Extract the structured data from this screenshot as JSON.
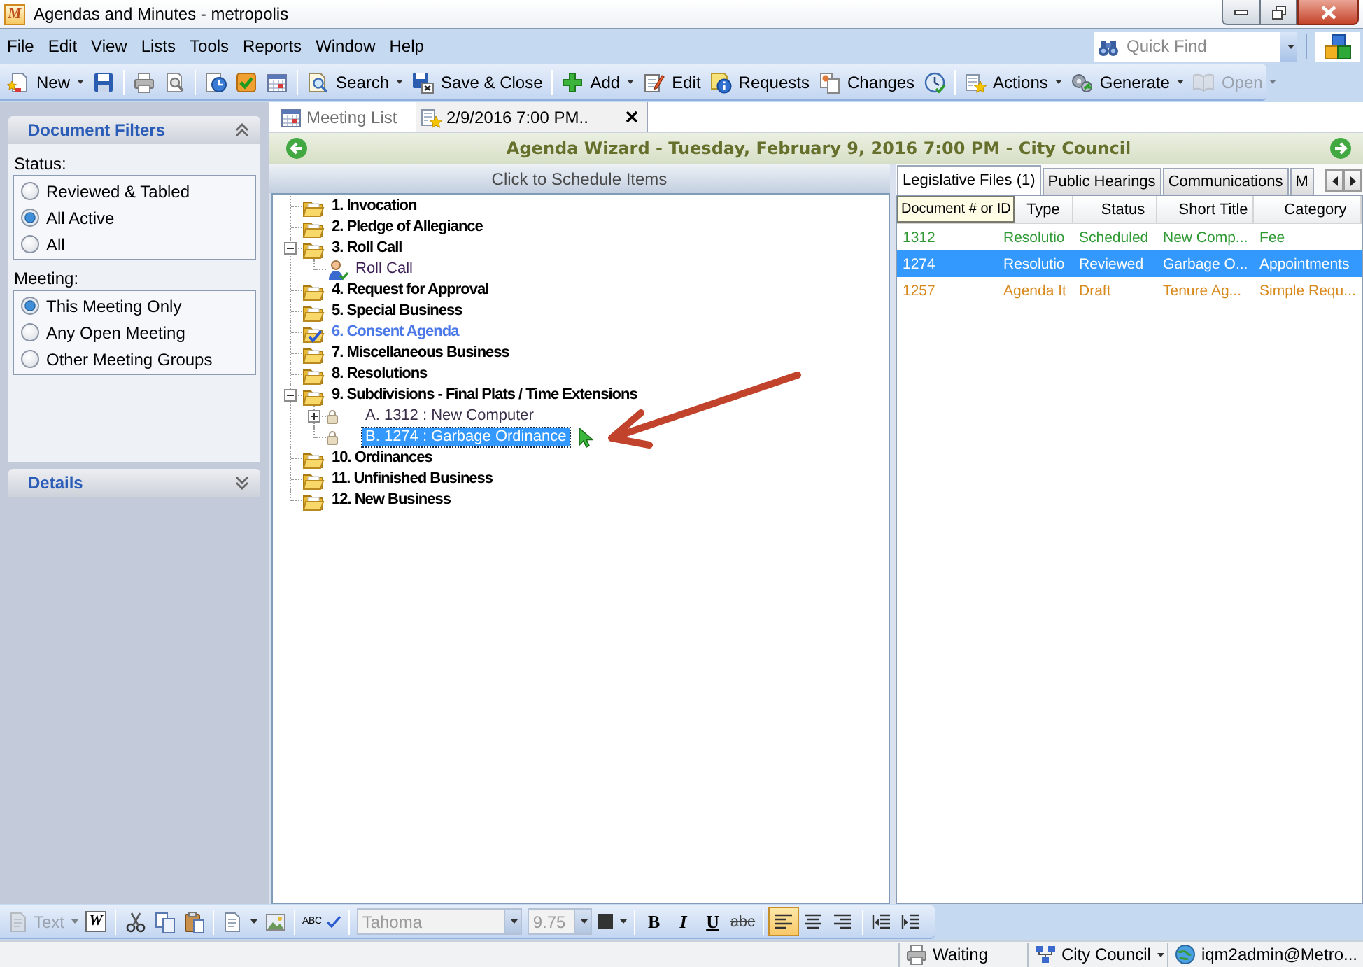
{
  "window": {
    "logo": "M",
    "title": "Agendas and Minutes - metropolis"
  },
  "menu": [
    "File",
    "Edit",
    "View",
    "Lists",
    "Tools",
    "Reports",
    "Window",
    "Help"
  ],
  "quick_find": {
    "placeholder": "Quick Find"
  },
  "toolbar": {
    "groups": [
      [
        {
          "label": "New",
          "dropdown": true,
          "disabled": false
        },
        {
          "dropdown": false,
          "disabled": false
        }
      ],
      [
        {
          "dropdown": false,
          "disabled": false
        },
        {
          "dropdown": false,
          "disabled": false
        }
      ],
      [
        {
          "dropdown": false,
          "disabled": false
        },
        {
          "dropdown": false,
          "disabled": false
        },
        {
          "dropdown": false,
          "disabled": false
        }
      ],
      [
        {
          "label": "Search",
          "dropdown": true,
          "disabled": false
        },
        {
          "label": "Save & Close",
          "dropdown": false,
          "disabled": false
        }
      ],
      [
        {
          "label": "Add",
          "dropdown": true,
          "disabled": false
        },
        {
          "label": "Edit",
          "dropdown": false,
          "disabled": false
        },
        {
          "label": "Requests",
          "dropdown": false,
          "disabled": false
        },
        {
          "label": "Changes",
          "dropdown": false,
          "disabled": false
        },
        {
          "dropdown": false,
          "disabled": false
        }
      ],
      [
        {
          "label": "Actions",
          "dropdown": true,
          "disabled": false
        },
        {
          "label": "Generate",
          "dropdown": true,
          "disabled": false
        },
        {
          "label": "Open",
          "dropdown": true,
          "disabled": true
        }
      ]
    ]
  },
  "filter_panel": {
    "title": "Document Filters",
    "expanded": true,
    "groups": [
      {
        "label": "Status:",
        "options": [
          {
            "label": "Reviewed & Tabled",
            "selected": false
          },
          {
            "label": "All Active",
            "selected": true
          },
          {
            "label": "All",
            "selected": false
          }
        ]
      },
      {
        "label": "Meeting:",
        "options": [
          {
            "label": "This Meeting Only",
            "selected": true
          },
          {
            "label": "Any Open Meeting",
            "selected": false
          },
          {
            "label": "Other Meeting Groups",
            "selected": false
          }
        ]
      }
    ]
  },
  "details_panel": {
    "title": "Details",
    "expanded": false
  },
  "document_tabs": [
    {
      "label": "Meeting List",
      "selected": false,
      "closable": false
    },
    {
      "label": "2/9/2016 7:00 PM..",
      "selected": true,
      "closable": true
    }
  ],
  "wizard": {
    "title": "Agenda Wizard - Tuesday, February 9, 2016 7:00 PM - City Council"
  },
  "schedule": {
    "header": "Click to Schedule Items",
    "tree": [
      {
        "label": "1. Invocation",
        "kind": "section",
        "selected": false
      },
      {
        "label": "2. Pledge of Allegiance",
        "kind": "section",
        "selected": false
      },
      {
        "label": "3. Roll Call",
        "kind": "section",
        "selected": false,
        "expanded": true,
        "children": [
          {
            "label": "Roll Call",
            "kind": "attendance",
            "selected": false
          }
        ]
      },
      {
        "label": "4. Request for Approval",
        "kind": "section",
        "selected": false
      },
      {
        "label": "5. Special Business",
        "kind": "section",
        "selected": false
      },
      {
        "label": "6. Consent Agenda",
        "kind": "consent",
        "selected": false
      },
      {
        "label": "7. Miscellaneous Business",
        "kind": "section",
        "selected": false
      },
      {
        "label": "8. Resolutions",
        "kind": "section",
        "selected": false
      },
      {
        "label": "9. Subdivisions - Final Plats / Time Extensions",
        "kind": "section",
        "selected": false,
        "expanded": true,
        "children": [
          {
            "label": "A. 1312 : New Computer",
            "kind": "file",
            "selected": false,
            "expanded": false
          },
          {
            "label": "B. 1274 : Garbage Ordinance",
            "kind": "file",
            "selected": true
          }
        ]
      },
      {
        "label": "10. Ordinances",
        "kind": "section",
        "selected": false
      },
      {
        "label": "11. Unfinished Business",
        "kind": "section",
        "selected": false
      },
      {
        "label": "12. New Business",
        "kind": "section",
        "selected": false
      }
    ]
  },
  "legislative": {
    "tabs": [
      {
        "label": "Legislative Files (1)",
        "selected": true
      },
      {
        "label": "Public Hearings",
        "selected": false
      },
      {
        "label": "Communications",
        "selected": false
      },
      {
        "label": "M",
        "selected": false
      }
    ],
    "columns": [
      {
        "label": "Document # or ID",
        "hovered": true
      },
      {
        "label": "Type",
        "hovered": false
      },
      {
        "label": "Status",
        "hovered": false
      },
      {
        "label": "Short Title",
        "hovered": false
      },
      {
        "label": "Category",
        "hovered": false
      }
    ],
    "rows": [
      {
        "cells": [
          "1312",
          "Resolutio",
          "Scheduled",
          "New Comp...",
          "Fee"
        ],
        "color": "#2f9a34",
        "selected": false
      },
      {
        "cells": [
          "1274",
          "Resolutio",
          "Reviewed",
          "Garbage O...",
          "Appointments"
        ],
        "selected": true
      },
      {
        "cells": [
          "1257",
          "Agenda It",
          "Draft",
          "Tenure Ag...",
          "Simple Requ..."
        ],
        "color": "#d8891c",
        "selected": false
      }
    ]
  },
  "format_toolbar": {
    "groups": [
      [
        {
          "kind": "dropdown",
          "label": "Text",
          "dropdown": true,
          "disabled": true
        },
        {
          "kind": "glyph",
          "label": "W",
          "disabled": false
        }
      ],
      [
        {
          "kind": "icon",
          "disabled": false
        },
        {
          "kind": "icon",
          "disabled": false
        },
        {
          "kind": "icon",
          "disabled": false
        }
      ],
      [
        {
          "kind": "icon",
          "dropdown": true,
          "disabled": false
        },
        {
          "kind": "icon",
          "disabled": false
        }
      ],
      [
        {
          "kind": "spell",
          "label": "ABC",
          "disabled": false
        }
      ],
      [
        {
          "kind": "field",
          "value": "Tahoma",
          "disabled": true
        },
        {
          "kind": "field",
          "value": "9.75",
          "disabled": true
        },
        {
          "kind": "icon",
          "dropdown": true,
          "disabled": false
        }
      ],
      [
        {
          "kind": "bold",
          "label": "B",
          "disabled": false
        },
        {
          "kind": "italic",
          "label": "I",
          "disabled": false
        },
        {
          "kind": "underline",
          "label": "U",
          "disabled": false
        },
        {
          "kind": "strike",
          "label": "abc",
          "disabled": false
        }
      ],
      [
        {
          "kind": "icon",
          "selected": true,
          "disabled": false
        },
        {
          "kind": "icon",
          "selected": false,
          "disabled": false
        },
        {
          "kind": "icon",
          "selected": false,
          "disabled": false
        }
      ],
      [
        {
          "kind": "icon",
          "disabled": false
        },
        {
          "kind": "icon",
          "disabled": false
        }
      ]
    ]
  },
  "status_bar": [
    {
      "label": "Waiting",
      "dropdown": false
    },
    {
      "label": "City Council",
      "dropdown": true
    },
    {
      "label": "iqm2admin@Metro...",
      "dropdown": false
    }
  ]
}
